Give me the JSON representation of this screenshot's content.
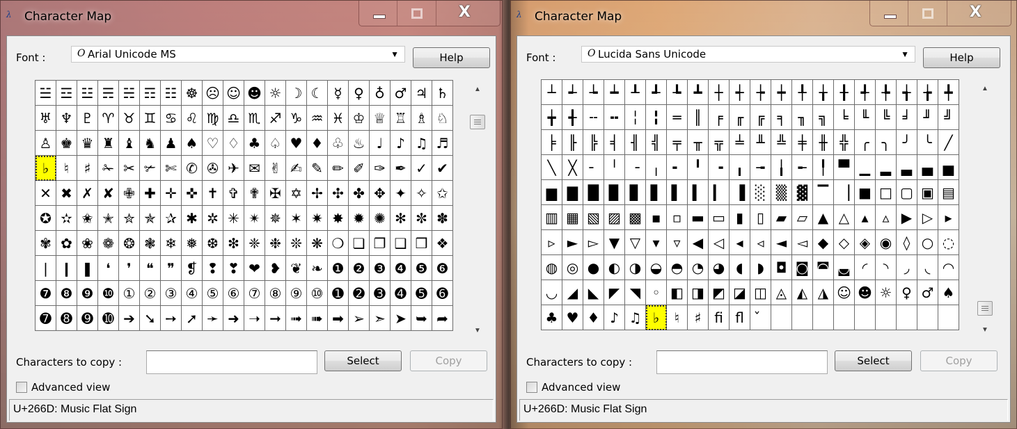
{
  "windows": [
    {
      "title": "Character Map",
      "app_icon": "λ",
      "caption": {
        "minimize": "minimize-icon",
        "maximize": "maximize-icon",
        "close": "X"
      },
      "font_label": "Font :",
      "font_icon": "O",
      "font_value": "Arial Unicode MS",
      "dropdown_arrow": "▼",
      "help_label": "Help",
      "selected_index": 60,
      "characters": [
        "☱",
        "☲",
        "☳",
        "☴",
        "☵",
        "☶",
        "☷",
        "☸",
        "☹",
        "☺",
        "☻",
        "☼",
        "☽",
        "☾",
        "☿",
        "♀",
        "♁",
        "♂",
        "♃",
        "♄",
        "♅",
        "♆",
        "♇",
        "♈",
        "♉",
        "♊",
        "♋",
        "♌",
        "♍",
        "♎",
        "♏",
        "♐",
        "♑",
        "♒",
        "♓",
        "♔",
        "♕",
        "♖",
        "♗",
        "♘",
        "♙",
        "♚",
        "♛",
        "♜",
        "♝",
        "♞",
        "♟",
        "♠",
        "♡",
        "♢",
        "♣",
        "♤",
        "♥",
        "♦",
        "♧",
        "♨",
        "♩",
        "♪",
        "♫",
        "♬",
        "♭",
        "♮",
        "♯",
        "✁",
        "✂",
        "✃",
        "✄",
        "✆",
        "✇",
        "✈",
        "✉",
        "✌",
        "✍",
        "✎",
        "✏",
        "✐",
        "✑",
        "✒",
        "✓",
        "✔",
        "✕",
        "✖",
        "✗",
        "✘",
        "✙",
        "✚",
        "✛",
        "✜",
        "✝",
        "✞",
        "✟",
        "✠",
        "✡",
        "✢",
        "✣",
        "✤",
        "✥",
        "✦",
        "✧",
        "✩",
        "✪",
        "✫",
        "✬",
        "✭",
        "✮",
        "✯",
        "✰",
        "✱",
        "✲",
        "✳",
        "✴",
        "✵",
        "✶",
        "✷",
        "✸",
        "✹",
        "✺",
        "✻",
        "✼",
        "✽",
        "✾",
        "✿",
        "❀",
        "❁",
        "❂",
        "❃",
        "❄",
        "❅",
        "❆",
        "❇",
        "❈",
        "❉",
        "❊",
        "❋",
        "❍",
        "❏",
        "❐",
        "❑",
        "❒",
        "❖",
        "❘",
        "❙",
        "❚",
        "❛",
        "❜",
        "❝",
        "❞",
        "❡",
        "❢",
        "❣",
        "❤",
        "❥",
        "❦",
        "❧",
        "❶",
        "❷",
        "❸",
        "❹",
        "❺",
        "❻",
        "❼",
        "❽",
        "❾",
        "❿",
        "①",
        "②",
        "③",
        "④",
        "⑤",
        "⑥",
        "⑦",
        "⑧",
        "⑨",
        "⑩",
        "➊",
        "➋",
        "➌",
        "➍",
        "➎",
        "➏",
        "➐",
        "➑",
        "➒",
        "➓",
        "➔",
        "➘",
        "➙",
        "➚",
        "➛",
        "➜",
        "➝",
        "➞",
        "➟",
        "➠",
        "➡",
        "➢",
        "➣",
        "➤",
        "➥",
        "➦"
      ],
      "scroll_up": "▲",
      "scroll_down": "▼",
      "copy_label": "Characters to copy :",
      "copy_value": "",
      "select_label": "Select",
      "copy_button_label": "Copy",
      "advanced_label": "Advanced view",
      "advanced_checked": false,
      "status_text": "U+266D: Music Flat Sign"
    },
    {
      "title": "Character Map",
      "app_icon": "λ",
      "caption": {
        "minimize": "minimize-icon",
        "maximize": "maximize-icon",
        "close": "X"
      },
      "font_label": "Font :",
      "font_icon": "O",
      "font_value": "Lucida Sans Unicode",
      "dropdown_arrow": "▼",
      "help_label": "Help",
      "selected_index": 185,
      "characters": [
        "┴",
        "┵",
        "┶",
        "┷",
        "┸",
        "┹",
        "┺",
        "┻",
        "┼",
        "┽",
        "┾",
        "┿",
        "╀",
        "╁",
        "╂",
        "╃",
        "╄",
        "╅",
        "╆",
        "╇",
        "╈",
        "╉",
        "╌",
        "╍",
        "╎",
        "╏",
        "═",
        "║",
        "╒",
        "╓",
        "╔",
        "╕",
        "╖",
        "╗",
        "╘",
        "╙",
        "╚",
        "╛",
        "╜",
        "╝",
        "╞",
        "╟",
        "╠",
        "╡",
        "╢",
        "╣",
        "╤",
        "╥",
        "╦",
        "╧",
        "╨",
        "╩",
        "╪",
        "╫",
        "╬",
        "╭",
        "╮",
        "╯",
        "╰",
        "╱",
        "╲",
        "╳",
        "╴",
        "╵",
        "╶",
        "╷",
        "╸",
        "╹",
        "╺",
        "╻",
        "╼",
        "╽",
        "╾",
        "╿",
        "▀",
        "▁",
        "▂",
        "▃",
        "▄",
        "▅",
        "▆",
        "▇",
        "█",
        "▉",
        "▊",
        "▋",
        "▌",
        "▍",
        "▎",
        "▐",
        "░",
        "▒",
        "▓",
        "▔",
        "▕",
        "■",
        "□",
        "▢",
        "▣",
        "▤",
        "▥",
        "▦",
        "▧",
        "▨",
        "▩",
        "▪",
        "▫",
        "▬",
        "▭",
        "▮",
        "▯",
        "▰",
        "▱",
        "▲",
        "△",
        "▴",
        "▵",
        "▶",
        "▷",
        "▸",
        "▹",
        "►",
        "▻",
        "▼",
        "▽",
        "▾",
        "▿",
        "◀",
        "◁",
        "◂",
        "◃",
        "◄",
        "◅",
        "◆",
        "◇",
        "◈",
        "◉",
        "◊",
        "○",
        "◌",
        "◍",
        "◎",
        "●",
        "◐",
        "◑",
        "◒",
        "◓",
        "◔",
        "◕",
        "◖",
        "◗",
        "◘",
        "◙",
        "◚",
        "◛",
        "◜",
        "◝",
        "◞",
        "◟",
        "◠",
        "◡",
        "◢",
        "◣",
        "◤",
        "◥",
        "◦",
        "◧",
        "◨",
        "◩",
        "◪",
        "◫",
        "◬",
        "◭",
        "◮",
        "☺",
        "☻",
        "☼",
        "♀",
        "♂",
        "♠",
        "♣",
        "♥",
        "♦",
        "♪",
        "♫",
        "♭",
        "♮",
        "♯",
        "ﬁ",
        "ﬂ",
        "̌",
        "",
        "",
        "",
        "",
        "",
        "",
        "",
        "",
        ""
      ],
      "scroll_up": "▲",
      "scroll_down": "▼",
      "copy_label": "Characters to copy :",
      "copy_value": "",
      "select_label": "Select",
      "copy_button_label": "Copy",
      "advanced_label": "Advanced view",
      "advanced_checked": false,
      "status_text": "U+266D: Music Flat Sign"
    }
  ]
}
